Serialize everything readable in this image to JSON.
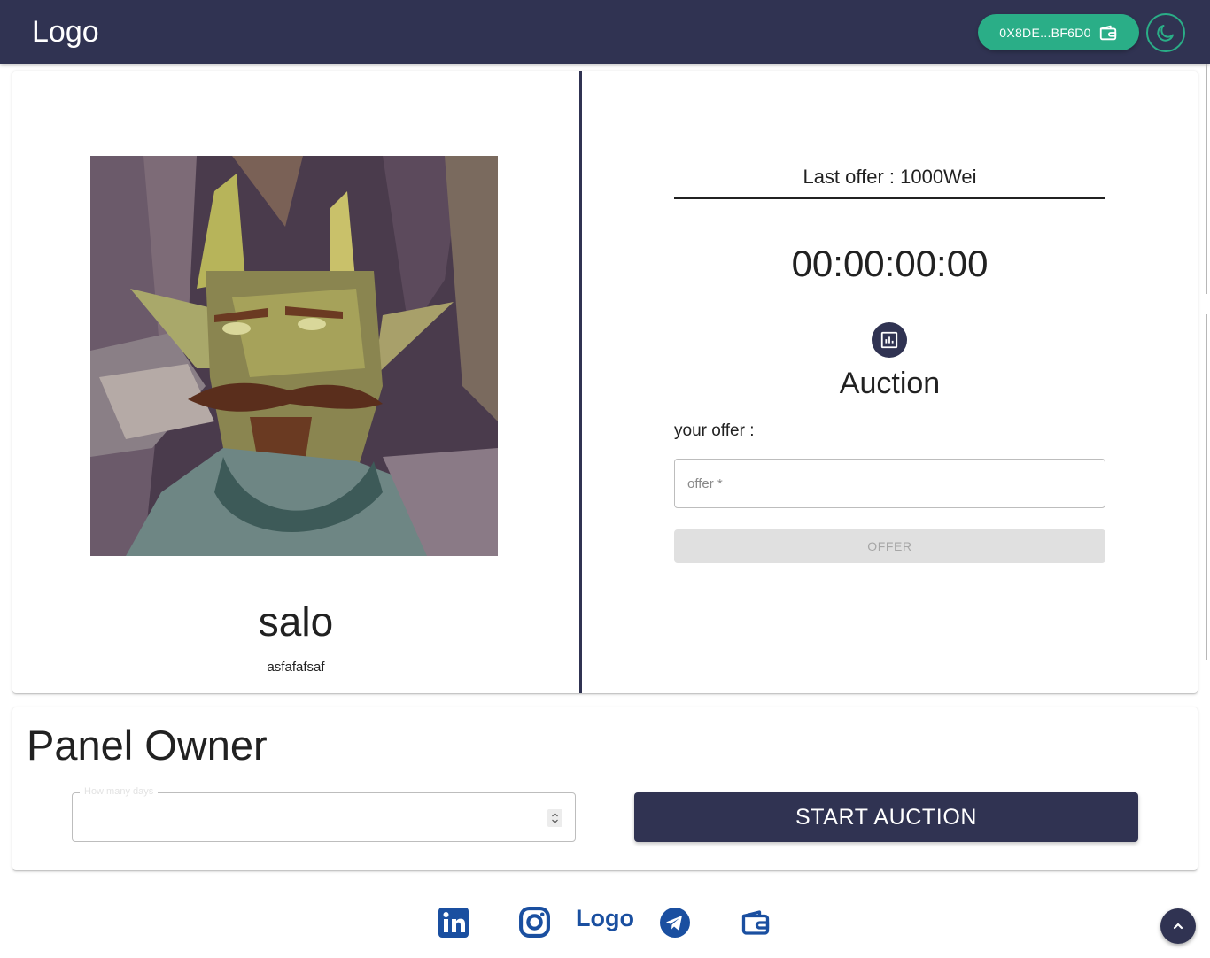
{
  "header": {
    "logo": "Logo",
    "wallet_address": "0X8DE...BF6D0",
    "wallet_icon": "wallet-icon",
    "theme_icon": "moon-icon",
    "colors": {
      "bar": "#303352",
      "accent": "#2aae87"
    }
  },
  "nft": {
    "name": "salo",
    "description": "asfafafsaf",
    "image": "pixel-art goblin portrait with mustache"
  },
  "auction": {
    "last_offer": "Last offer : 1000Wei",
    "timer": "00:00:00:00",
    "icon": "bar-chart-icon",
    "title": "Auction",
    "your_offer_label": "your offer :",
    "offer_placeholder": "offer *",
    "offer_button": "OFFER"
  },
  "panel": {
    "title": "Panel Owner",
    "days_label": "How many days",
    "start_button": "START AUCTION"
  },
  "footer": {
    "logo": "Logo",
    "icons": [
      "linkedin-icon",
      "instagram-icon",
      "telegram-icon",
      "wallet-icon"
    ],
    "scroll_top_icon": "chevron-up-icon"
  }
}
